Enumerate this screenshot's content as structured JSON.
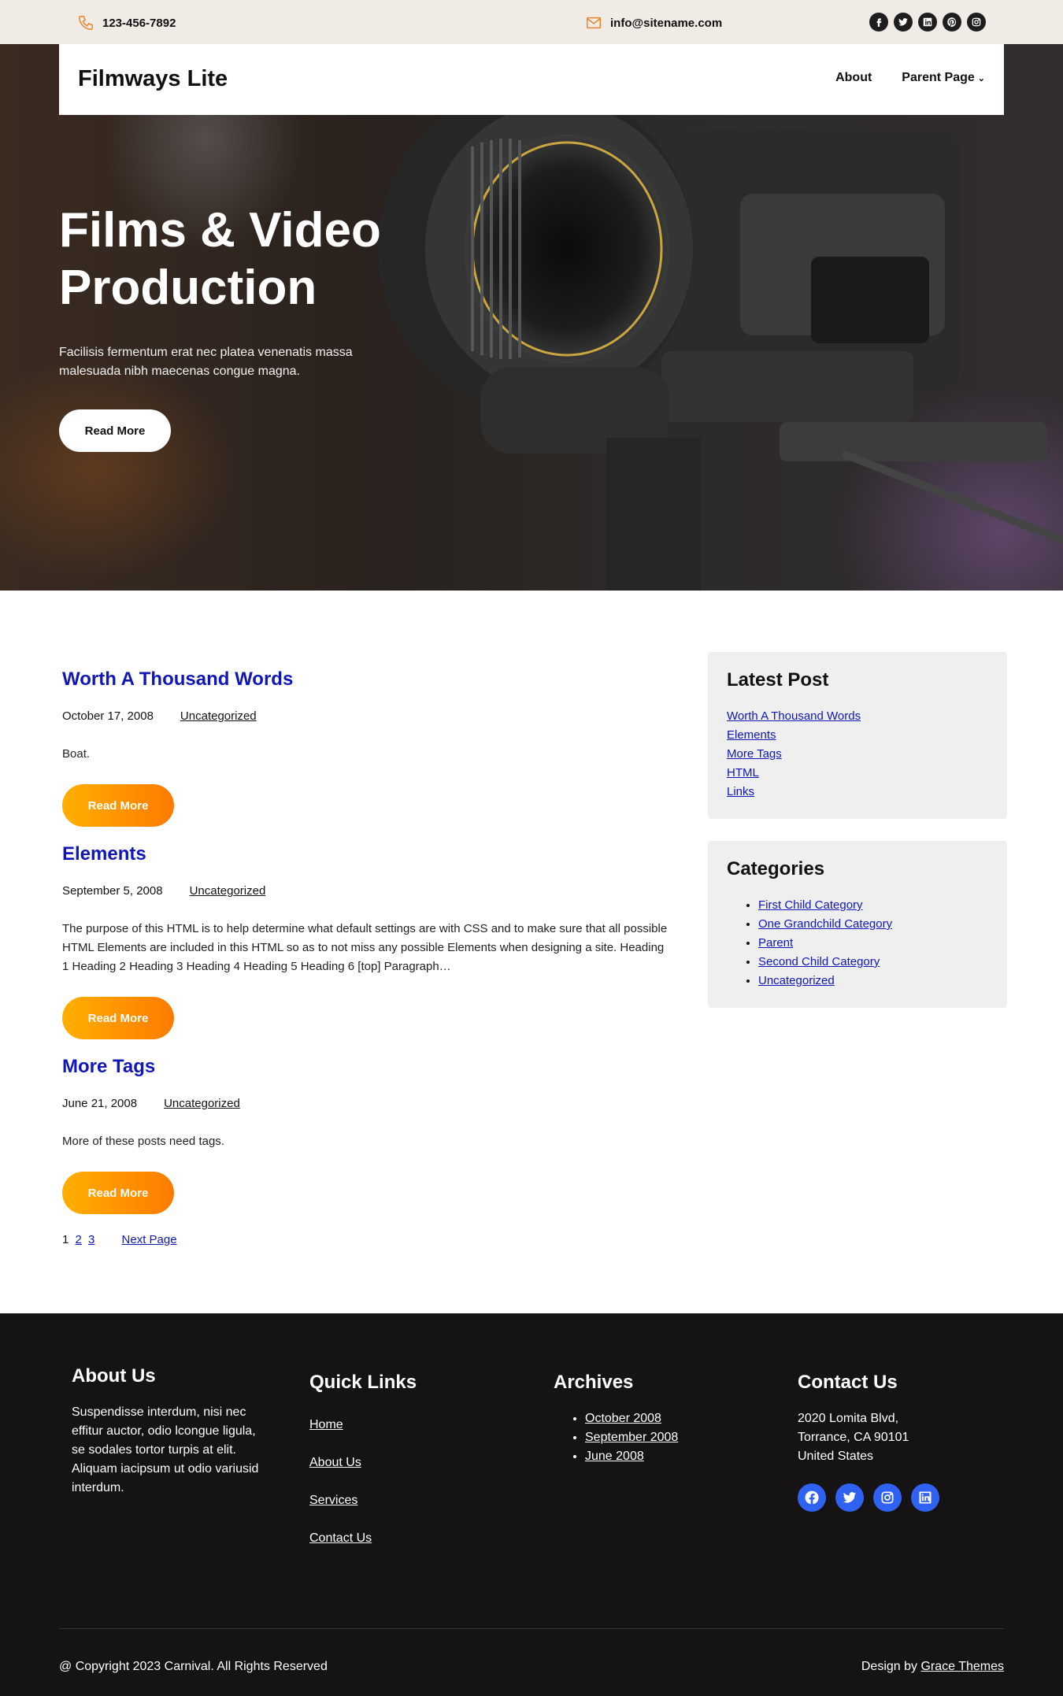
{
  "topbar": {
    "phone": "123-456-7892",
    "email": "info@sitename.com",
    "social_icons": [
      "facebook-icon",
      "twitter-icon",
      "linkedin-icon",
      "pinterest-icon",
      "instagram-icon"
    ]
  },
  "header": {
    "logo": "Filmways Lite",
    "nav": [
      {
        "label": "About"
      },
      {
        "label": "Parent Page",
        "has_dropdown": true
      }
    ]
  },
  "hero": {
    "title": "Films & Video Production",
    "subtitle": "Facilisis fermentum erat nec platea venenatis massa malesuada nibh maecenas congue magna.",
    "button": "Read More"
  },
  "posts": [
    {
      "title": "Worth A Thousand Words",
      "date": "October 17, 2008",
      "category": "Uncategorized",
      "excerpt": "Boat.",
      "button": "Read More"
    },
    {
      "title": "Elements",
      "date": "September 5, 2008",
      "category": "Uncategorized",
      "excerpt": "The purpose of this HTML is to help determine what default settings are with CSS and to make sure that all possible HTML Elements are included in this HTML so as to not miss any possible Elements when designing a site. Heading 1 Heading 2 Heading 3 Heading 4 Heading 5 Heading 6 [top] Paragraph…",
      "button": "Read More"
    },
    {
      "title": "More Tags",
      "date": "June 21, 2008",
      "category": "Uncategorized",
      "excerpt": "More of these posts need tags.",
      "button": "Read More"
    }
  ],
  "pagination": {
    "current": "1",
    "pages": [
      "2",
      "3"
    ],
    "next": "Next Page"
  },
  "sidebar": {
    "latest": {
      "title": "Latest Post",
      "items": [
        "Worth A Thousand Words",
        "Elements",
        "More Tags",
        "HTML",
        "Links"
      ]
    },
    "categories": {
      "title": "Categories",
      "items": [
        "First Child Category",
        "One Grandchild Category",
        "Parent",
        "Second Child Category",
        "Uncategorized"
      ]
    }
  },
  "footer": {
    "about": {
      "title": "About Us",
      "text": "Suspendisse interdum, nisi nec effitur auctor, odio lcongue ligula, se sodales tortor turpis at elit. Aliquam iacipsum ut odio variusid interdum."
    },
    "quick_links": {
      "title": "Quick Links",
      "items": [
        "Home",
        "About Us",
        "Services",
        "Contact Us"
      ]
    },
    "archives": {
      "title": "Archives",
      "items": [
        "October 2008",
        "September 2008",
        "June 2008"
      ]
    },
    "contact": {
      "title": "Contact Us",
      "address_line1": "2020 Lomita Blvd,",
      "address_line2": "Torrance, CA 90101",
      "address_line3": "United States",
      "social_icons": [
        "facebook-icon",
        "twitter-icon",
        "instagram-icon",
        "linkedin-icon"
      ]
    },
    "copyright": "@ Copyright 2023 Carnival. All Rights Reserved",
    "design_by_prefix": "Design by",
    "design_by_link": "Grace Themes"
  },
  "colors": {
    "topbar_bg": "#f1ebe6",
    "accent_orange": "#ff8a00",
    "link_blue": "#1016b8",
    "footer_bg": "#151314",
    "footer_social_bg": "#2f62f0"
  }
}
